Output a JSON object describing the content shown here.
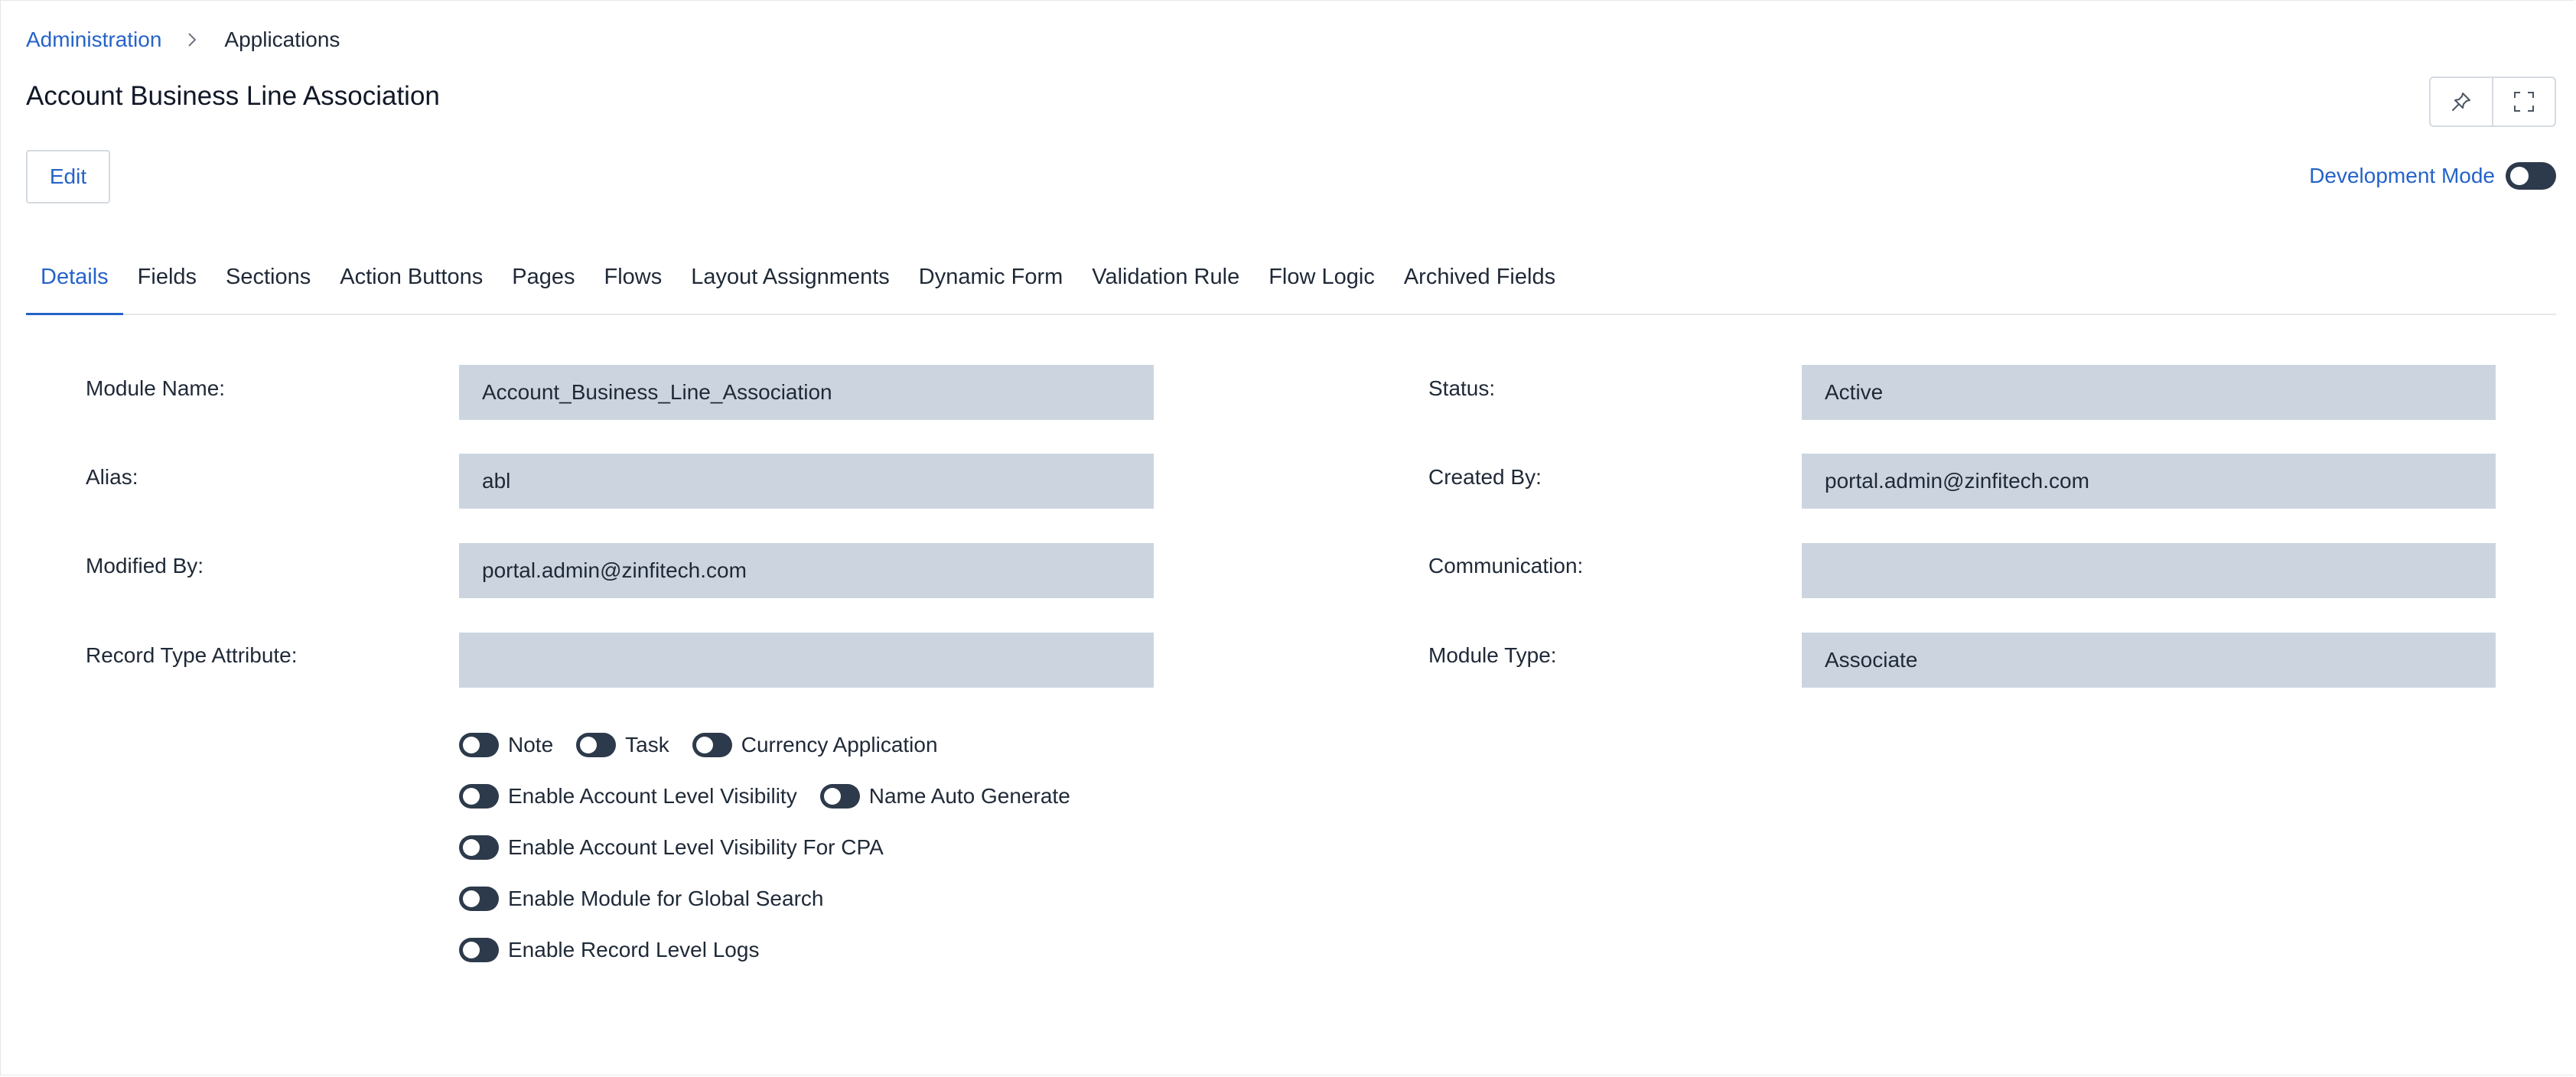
{
  "breadcrumb": {
    "root": "Administration",
    "current": "Applications"
  },
  "page": {
    "title": "Account Business Line Association"
  },
  "toolbar": {
    "edit_label": "Edit",
    "dev_mode_label": "Development Mode"
  },
  "icons": {
    "pin": "pin-icon",
    "fullscreen": "fullscreen-icon",
    "chevron": "chevron-right-icon"
  },
  "tabs": [
    "Details",
    "Fields",
    "Sections",
    "Action Buttons",
    "Pages",
    "Flows",
    "Layout Assignments",
    "Dynamic Form",
    "Validation Rule",
    "Flow Logic",
    "Archived Fields"
  ],
  "fields": {
    "module_name": {
      "label": "Module Name:",
      "value": "Account_Business_Line_Association"
    },
    "status": {
      "label": "Status:",
      "value": "Active"
    },
    "alias": {
      "label": "Alias:",
      "value": "abl"
    },
    "created_by": {
      "label": "Created By:",
      "value": "portal.admin@zinfitech.com"
    },
    "modified_by": {
      "label": "Modified By:",
      "value": "portal.admin@zinfitech.com"
    },
    "communication": {
      "label": "Communication:",
      "value": ""
    },
    "record_type_attribute": {
      "label": "Record Type Attribute:",
      "value": ""
    },
    "module_type": {
      "label": "Module Type:",
      "value": "Associate"
    }
  },
  "toggles": {
    "note": "Note",
    "task": "Task",
    "currency_application": "Currency Application",
    "account_level_visibility": "Enable Account Level Visibility",
    "name_auto_generate": "Name Auto Generate",
    "account_level_visibility_cpa": "Enable Account Level Visibility For CPA",
    "global_search": "Enable Module for Global Search",
    "record_level_logs": "Enable Record Level Logs"
  },
  "colors": {
    "accent": "#2563c9",
    "field_bg": "#ccd5df",
    "toggle": "#2d3a4b"
  }
}
